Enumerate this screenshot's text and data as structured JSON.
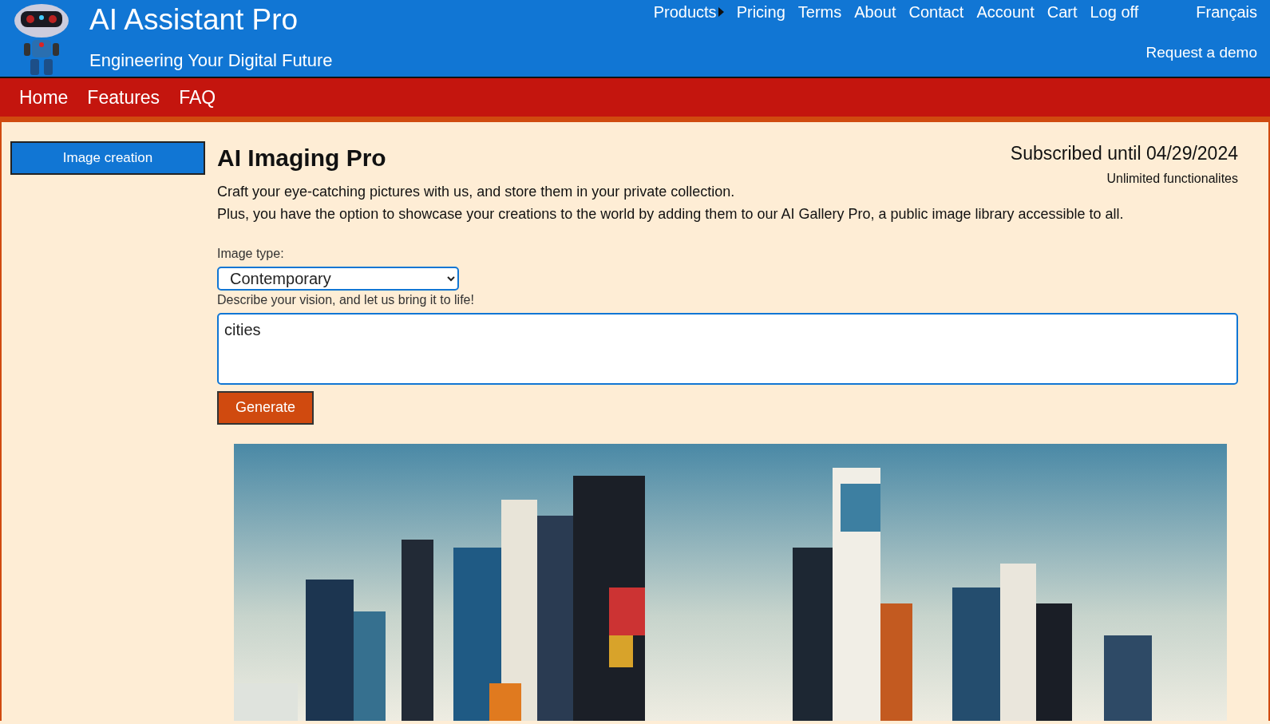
{
  "header": {
    "title": "AI Assistant Pro",
    "tagline": "Engineering Your Digital Future",
    "nav": [
      {
        "label": "Products",
        "submenu": true
      },
      {
        "label": "Pricing",
        "submenu": false
      },
      {
        "label": "Terms",
        "submenu": false
      },
      {
        "label": "About",
        "submenu": false
      },
      {
        "label": "Contact",
        "submenu": false
      },
      {
        "label": "Account",
        "submenu": false
      },
      {
        "label": "Cart",
        "submenu": false
      },
      {
        "label": "Log off",
        "submenu": false
      }
    ],
    "language": "Français",
    "demo_link": "Request a demo"
  },
  "subnav": [
    "Home",
    "Features",
    "FAQ"
  ],
  "sidebar": {
    "items": [
      {
        "label": "Image creation",
        "selected": true
      }
    ]
  },
  "main": {
    "title": "AI Imaging Pro",
    "subscription": {
      "status": "Subscribed until 04/29/2024",
      "plan": "Unlimited functionalites"
    },
    "description": [
      "Craft your eye-catching pictures with us, and store them in your private collection.",
      "Plus, you have the option to showcase your creations to the world by adding them to our AI Gallery Pro, a public image library accessible to all."
    ],
    "form": {
      "type_label": "Image type:",
      "type_value": "Contemporary",
      "prompt_label": "Describe your vision, and let us bring it to life!",
      "prompt_value": "cities",
      "button": "Generate"
    }
  }
}
